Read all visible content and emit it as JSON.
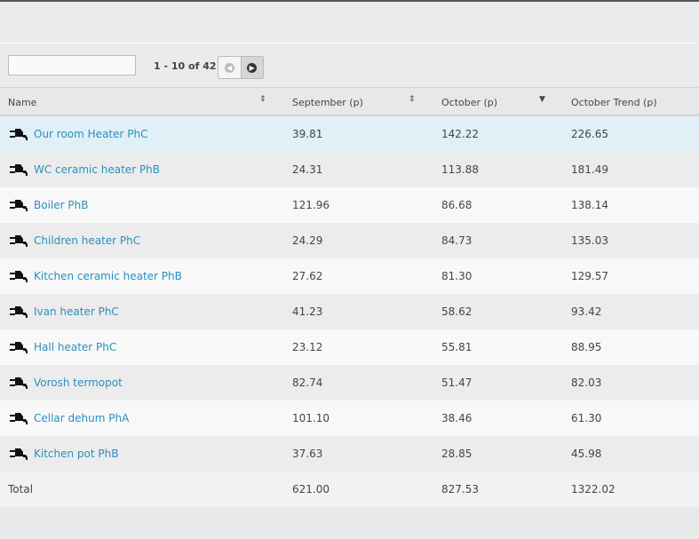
{
  "toolbar": {
    "search_value": "",
    "range": "1 - 10 of 42"
  },
  "columns": {
    "name": "Name",
    "september": "September (p)",
    "october": "October (p)",
    "trend": "October Trend (p)"
  },
  "rows": [
    {
      "name": "Our room Heater PhC",
      "sep": "39.81",
      "oct": "142.22",
      "trend": "226.65"
    },
    {
      "name": "WC ceramic heater PhB",
      "sep": "24.31",
      "oct": "113.88",
      "trend": "181.49"
    },
    {
      "name": "Boiler PhB",
      "sep": "121.96",
      "oct": "86.68",
      "trend": "138.14"
    },
    {
      "name": "Children heater PhC",
      "sep": "24.29",
      "oct": "84.73",
      "trend": "135.03"
    },
    {
      "name": "Kitchen ceramic heater PhB",
      "sep": "27.62",
      "oct": "81.30",
      "trend": "129.57"
    },
    {
      "name": "Ivan heater PhC",
      "sep": "41.23",
      "oct": "58.62",
      "trend": "93.42"
    },
    {
      "name": "Hall heater PhC",
      "sep": "23.12",
      "oct": "55.81",
      "trend": "88.95"
    },
    {
      "name": "Vorosh termopot",
      "sep": "82.74",
      "oct": "51.47",
      "trend": "82.03"
    },
    {
      "name": "Cellar dehum PhA",
      "sep": "101.10",
      "oct": "38.46",
      "trend": "61.30"
    },
    {
      "name": "Kitchen pot PhB",
      "sep": "37.63",
      "oct": "28.85",
      "trend": "45.98"
    }
  ],
  "total": {
    "label": "Total",
    "sep": "621.00",
    "oct": "827.53",
    "trend": "1322.02"
  },
  "colors": {
    "link": "#2a8fbd",
    "highlight": "#e1eff7"
  }
}
